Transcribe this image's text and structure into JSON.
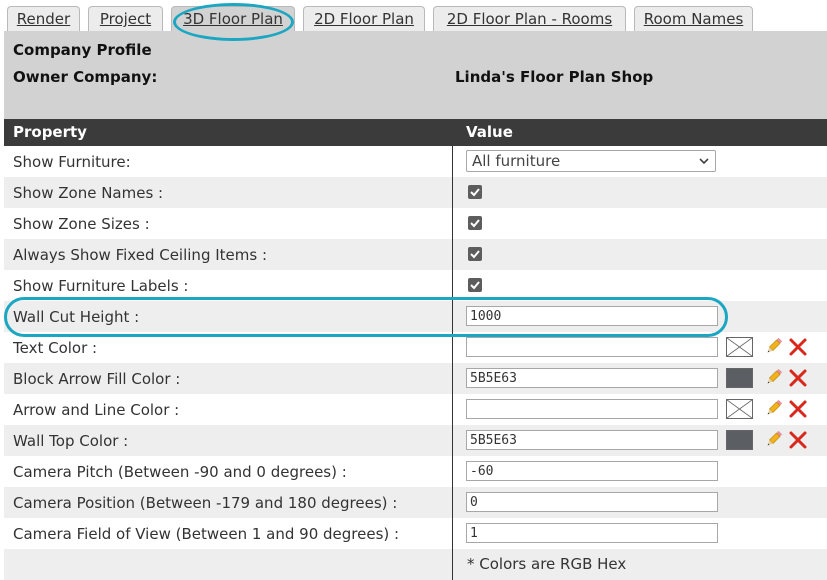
{
  "tabs": [
    {
      "label": "Render"
    },
    {
      "label": "Project"
    },
    {
      "label": "3D Floor Plan",
      "active": true
    },
    {
      "label": "2D Floor Plan"
    },
    {
      "label": "2D Floor Plan - Rooms"
    },
    {
      "label": "Room Names"
    }
  ],
  "profile": {
    "title": "Company Profile",
    "owner_label": "Owner Company:",
    "owner_value": "Linda's Floor Plan Shop"
  },
  "table": {
    "header_property": "Property",
    "header_value": "Value",
    "rows": [
      {
        "label": "Show Furniture:",
        "select_value": "All furniture"
      },
      {
        "label": "Show Zone Names :",
        "checked": true
      },
      {
        "label": "Show Zone Sizes :",
        "checked": true
      },
      {
        "label": "Always Show Fixed Ceiling Items :",
        "checked": true
      },
      {
        "label": "Show Furniture Labels :",
        "checked": true
      },
      {
        "label": "Wall Cut Height :",
        "value": "1000"
      },
      {
        "label": "Text Color :",
        "value": ""
      },
      {
        "label": "Block Arrow Fill Color :",
        "value": "5B5E63",
        "swatch_color": "#5B5E63"
      },
      {
        "label": "Arrow and Line Color :",
        "value": ""
      },
      {
        "label": "Wall Top Color :",
        "value": "5B5E63",
        "swatch_color": "#5B5E63"
      },
      {
        "label": "Camera Pitch (Between -90 and 0 degrees) :",
        "value": "-60"
      },
      {
        "label": "Camera Position (Between -179 and 180 degrees) :",
        "value": "0"
      },
      {
        "label": "Camera Field of View (Between 1 and 90 degrees) :",
        "value": "1"
      }
    ],
    "note": "* Colors are RGB Hex"
  },
  "colors": {
    "highlight": "#1ba6c2",
    "header_bg": "#3b3b3b",
    "delete_red": "#d9271c"
  },
  "icons": [
    "chevron-down-icon",
    "checkbox-checked-icon",
    "no-color-icon",
    "pencil-icon",
    "delete-icon"
  ]
}
